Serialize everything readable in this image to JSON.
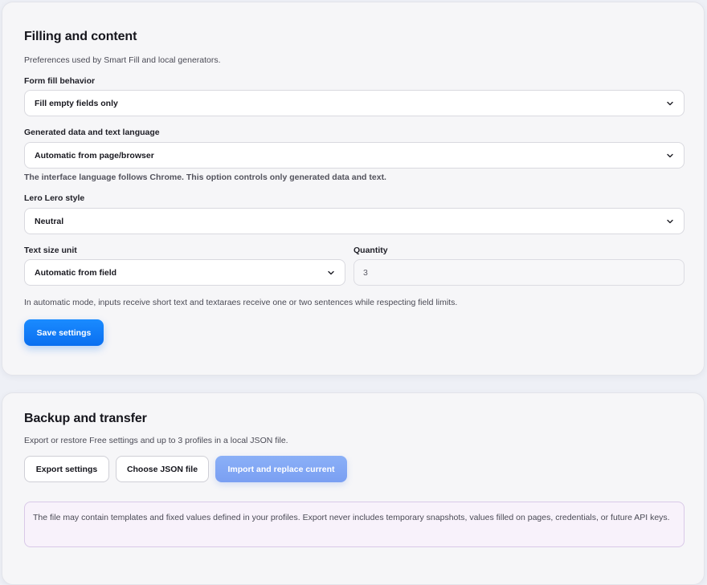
{
  "filling": {
    "title": "Filling and content",
    "subtitle": "Preferences used by Smart Fill and local generators.",
    "form_fill": {
      "label": "Form fill behavior",
      "value": "Fill empty fields only"
    },
    "language": {
      "label": "Generated data and text language",
      "value": "Automatic from page/browser",
      "hint": "The interface language follows Chrome. This option controls only generated data and text."
    },
    "lero_style": {
      "label": "Lero Lero style",
      "value": "Neutral"
    },
    "text_size_unit": {
      "label": "Text size unit",
      "value": "Automatic from field"
    },
    "quantity": {
      "label": "Quantity",
      "value": "3"
    },
    "auto_hint": "In automatic mode, inputs receive short text and textaraes receive one or two sentences while respecting field limits.",
    "save_label": "Save settings"
  },
  "backup": {
    "title": "Backup and transfer",
    "subtitle": "Export or restore Free settings and up to 3 profiles in a local JSON file.",
    "export_label": "Export settings",
    "choose_label": "Choose JSON file",
    "import_label": "Import and replace current",
    "notice": "The file may contain templates and fixed values defined in your profiles. Export never includes temporary snapshots, values filled on pages, credentials, or future API keys."
  },
  "icons": {
    "select_chevron": "chevron-down-icon"
  },
  "colors": {
    "accent": "#0a6ff0",
    "accent_disabled": "#7a9ff2",
    "notice_bg": "#f8f2fb",
    "notice_border": "#d9c9e8"
  }
}
